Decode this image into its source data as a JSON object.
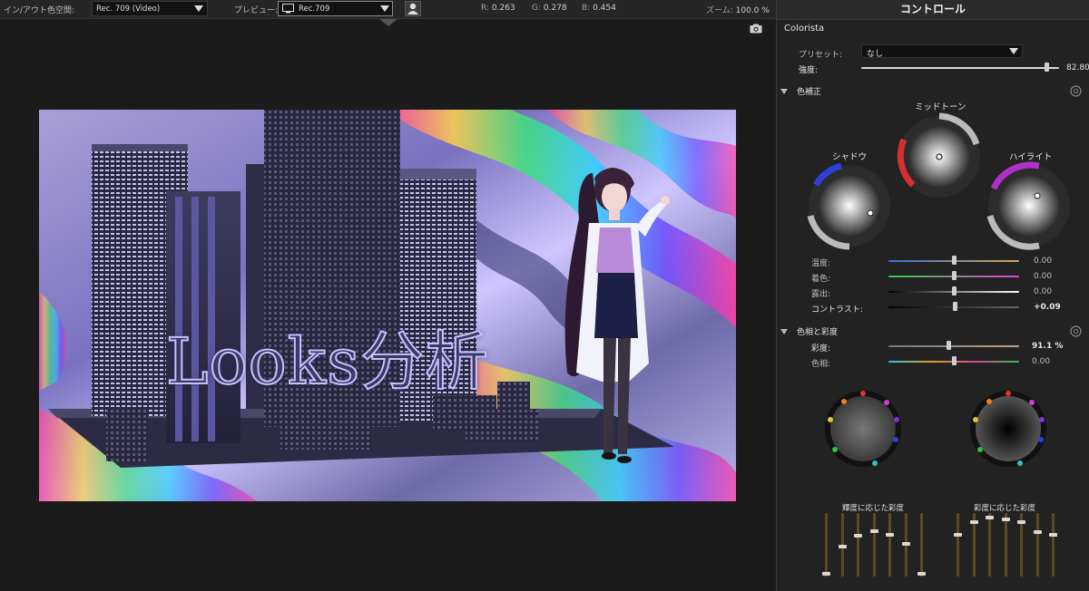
{
  "topbar": {
    "inout_label": "イン/アウト色空間:",
    "inout_value": "Rec. 709 (Video)",
    "preview_label": "プレビュー:",
    "preview_value": "Rec.709",
    "r_label": "R:",
    "r_value": "0.263",
    "g_label": "G:",
    "g_value": "0.278",
    "b_label": "B:",
    "b_value": "0.454",
    "zoom_label": "ズーム:",
    "zoom_value": "100.0 %"
  },
  "viewer": {
    "overlay_text": "Looks分析"
  },
  "panel": {
    "title": "コントロール",
    "effect_name": "Colorista",
    "preset_label": "プリセット:",
    "preset_value": "なし",
    "strength_label": "強度:",
    "strength_value": "82.80",
    "strength_fraction": 0.94,
    "color_correction": {
      "section_label": "色補正",
      "midtone_label": "ミッドトーン",
      "shadow_label": "シャドウ",
      "highlight_label": "ハイライト",
      "sliders": [
        {
          "label": "温度:",
          "value": "0.00",
          "fraction": 0.5,
          "bold": false
        },
        {
          "label": "着色:",
          "value": "0.00",
          "fraction": 0.5,
          "bold": false
        },
        {
          "label": "露出:",
          "value": "0.00",
          "fraction": 0.5,
          "bold": false
        },
        {
          "label": "コントラスト:",
          "value": "+0.09",
          "fraction": 0.51,
          "bold": true
        }
      ]
    },
    "hue_saturation": {
      "section_label": "色相と彩度",
      "sliders": [
        {
          "label": "彩度:",
          "value": "91.1 %",
          "fraction": 0.46,
          "bold": true
        },
        {
          "label": "色相:",
          "value": "0.00",
          "fraction": 0.5,
          "bold": false
        }
      ]
    },
    "luma_sat": {
      "label": "輝度に応じた彩度",
      "levels": [
        0.04,
        0.47,
        0.64,
        0.72,
        0.66,
        0.51,
        0.04
      ]
    },
    "sat_sat": {
      "label": "彩度に応じた彩度",
      "levels": [
        0.66,
        0.86,
        0.93,
        0.9,
        0.86,
        0.7,
        0.66
      ]
    },
    "colors": {
      "accent": "#3a7bd5",
      "fader_bar": "#5c4a20"
    }
  }
}
